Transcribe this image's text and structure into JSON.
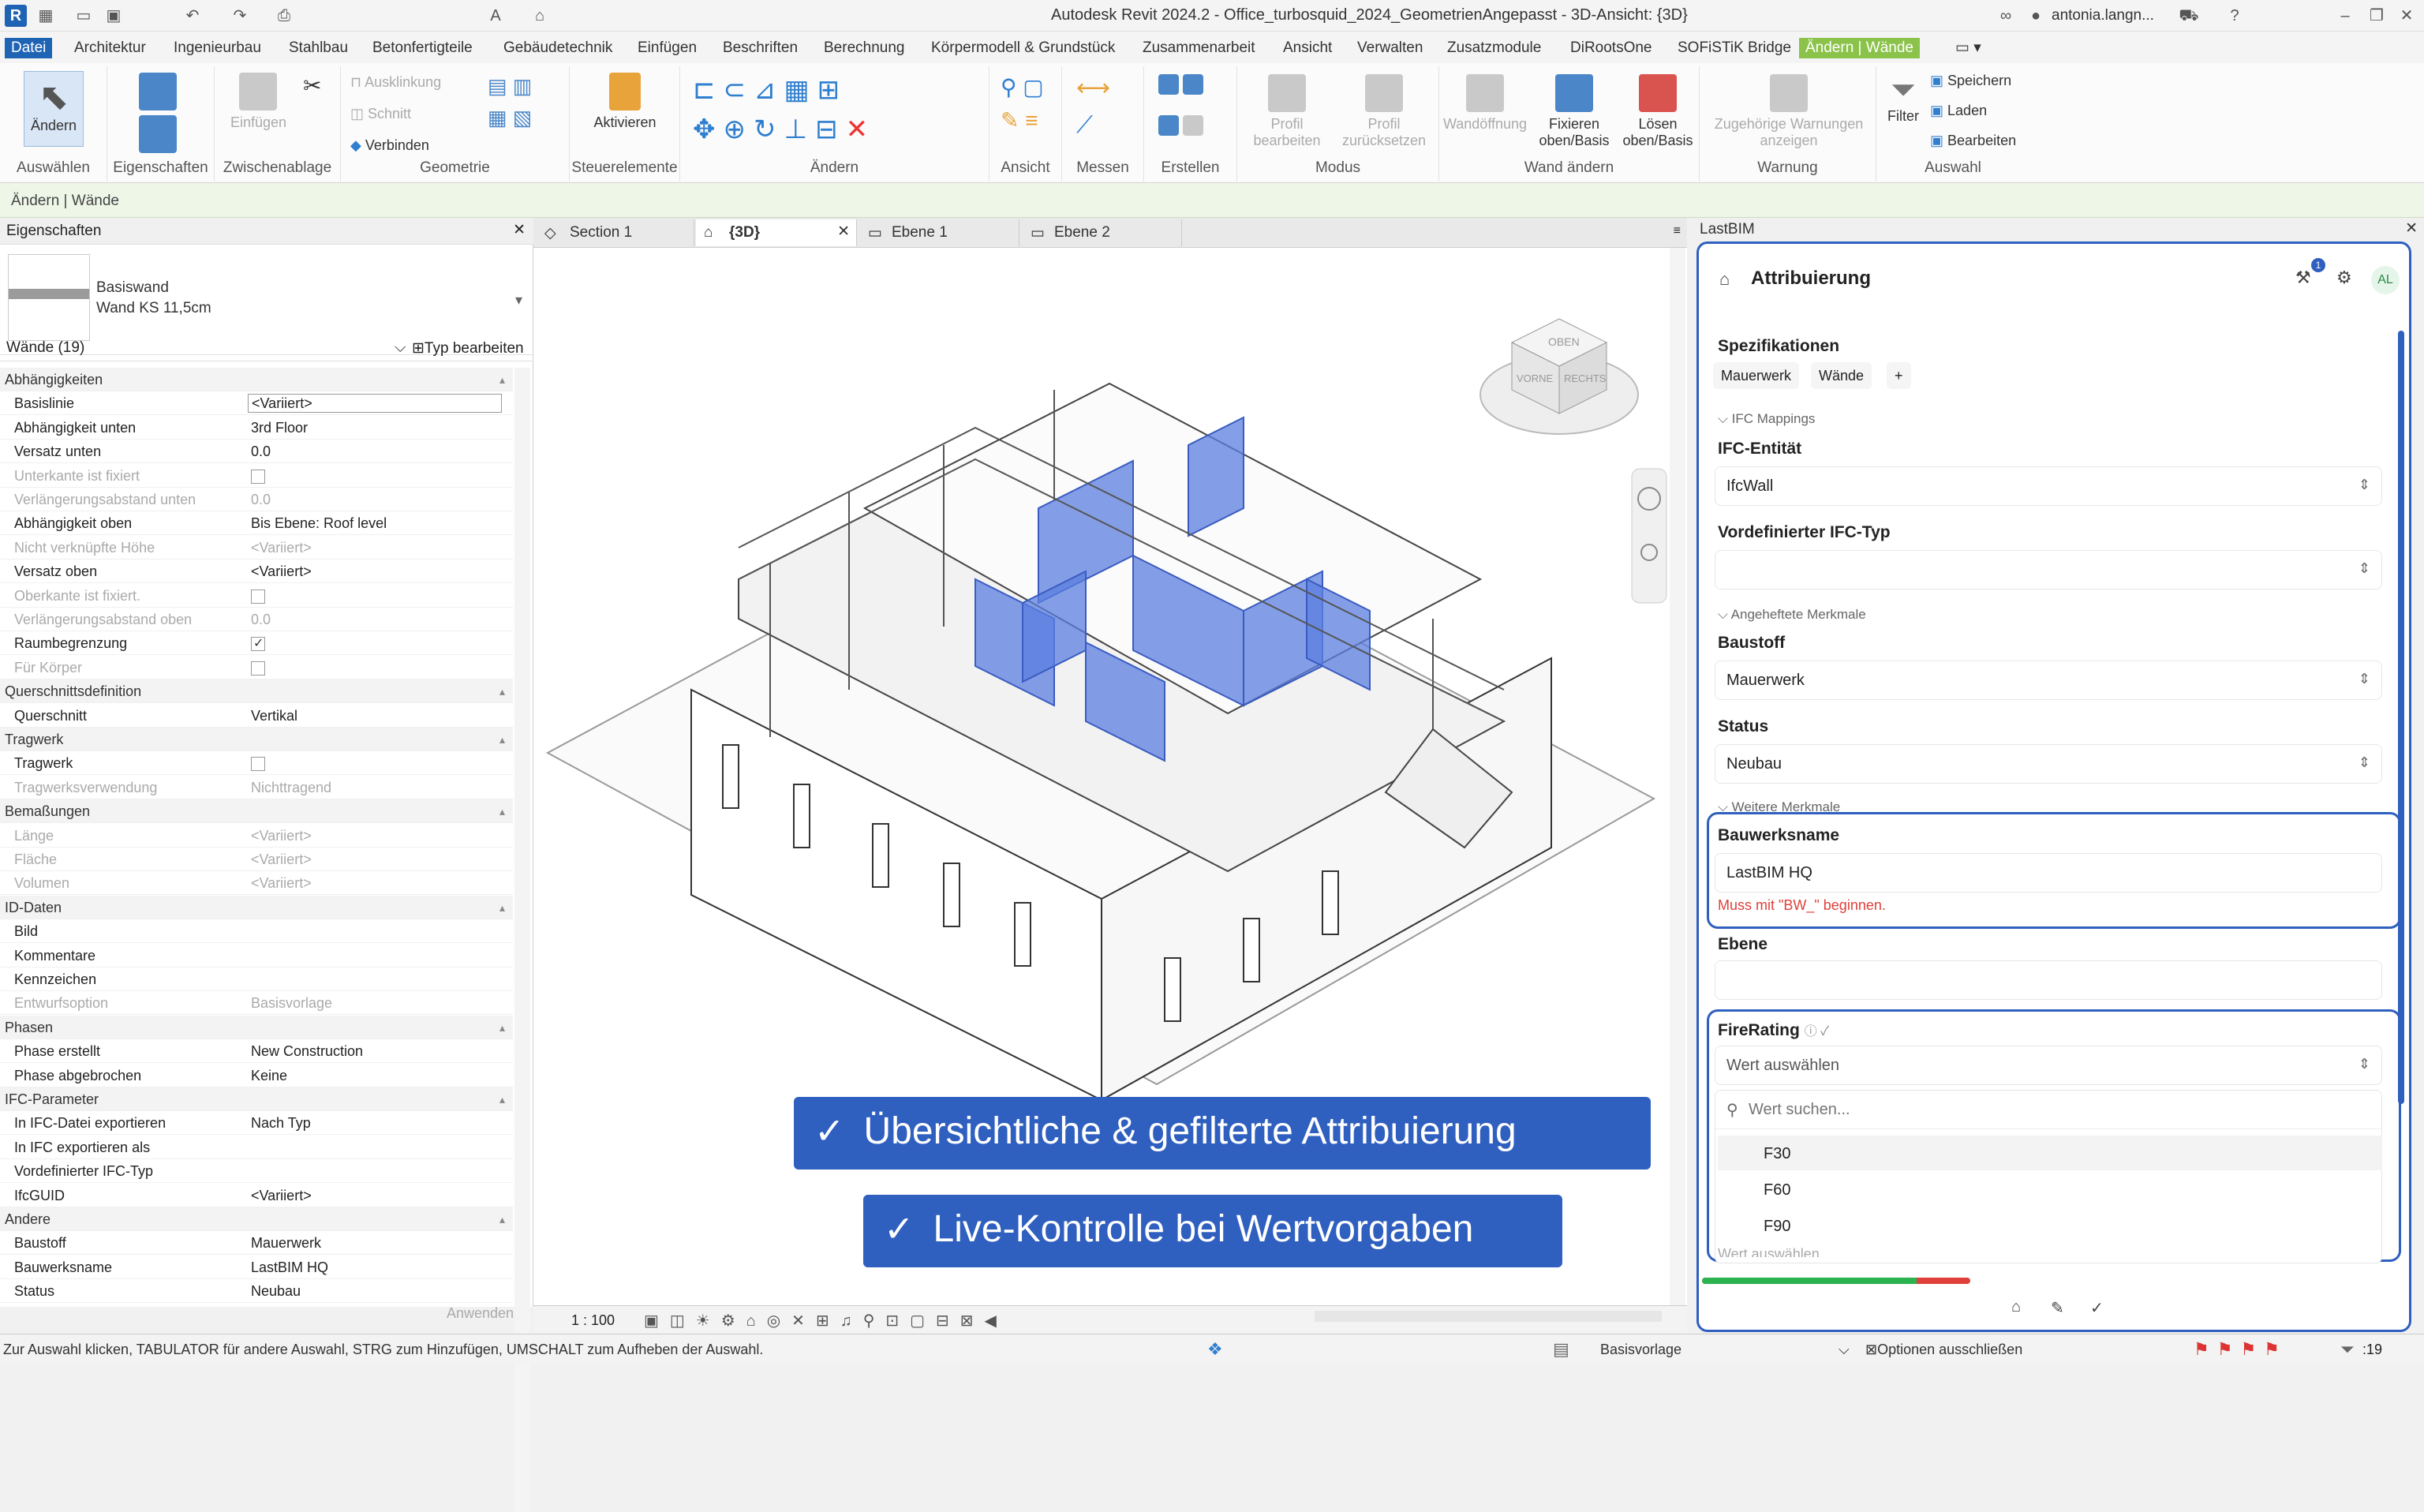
{
  "titlebar": {
    "title": "Autodesk Revit 2024.2 - Office_turbosquid_2024_GeometrienAngepasst - 3D-Ansicht: {3D}",
    "user": "antonia.langn..."
  },
  "menu": [
    "Datei",
    "Architektur",
    "Ingenieurbau",
    "Stahlbau",
    "Betonfertigteile",
    "Gebäudetechnik",
    "Einfügen",
    "Beschriften",
    "Berechnung",
    "Körpermodell & Grundstück",
    "Zusammenarbeit",
    "Ansicht",
    "Verwalten",
    "Zusatzmodule",
    "DiRootsOne",
    "SOFiSTiK Bridge",
    "Ändern | Wände"
  ],
  "ribbon": {
    "groups": [
      "Auswählen",
      "Eigenschaften",
      "Zwischenablage",
      "Geometrie",
      "Steuerelemente",
      "Ändern",
      "Ansicht",
      "Messen",
      "Erstellen",
      "Modus",
      "Wand ändern",
      "Warnung",
      "Auswahl"
    ],
    "btn_aendern": "Ändern",
    "btn_einfuegen": "Einfügen",
    "btn_ausklinkung": "Ausklinkung",
    "btn_schnitt": "Schnitt",
    "btn_verbinden": "Verbinden",
    "btn_aktivieren": "Aktivieren",
    "btn_profil_bearbeiten": "Profil bearbeiten",
    "btn_profil_zurueck": "Profil zurücksetzen",
    "btn_wandoeffnung": "Wandöffnung",
    "btn_fixieren": "Fixieren oben/Basis",
    "btn_loesen": "Lösen oben/Basis",
    "btn_warnungen": "Zugehörige Warnungen anzeigen",
    "btn_filter": "Filter",
    "btn_speichern": "Speichern",
    "btn_laden": "Laden",
    "btn_bearbeiten": "Bearbeiten"
  },
  "context_bar": "Ändern | Wände",
  "properties": {
    "header": "Eigenschaften",
    "type_name_1": "Basiswand",
    "type_name_2": "Wand KS 11,5cm",
    "filter": "Wände (19)",
    "edit_type": "Typ bearbeiten",
    "rows": [
      {
        "k": "Abhängigkeiten",
        "sec": true
      },
      {
        "k": "Basislinie",
        "v": "<Variiert>"
      },
      {
        "k": "Abhängigkeit unten",
        "v": "3rd Floor"
      },
      {
        "k": "Versatz unten",
        "v": "0.0"
      },
      {
        "k": "Unterkante ist fixiert",
        "cb": false,
        "dis": true
      },
      {
        "k": "Verlängerungsabstand unten",
        "v": "0.0",
        "dis": true
      },
      {
        "k": "Abhängigkeit oben",
        "v": "Bis Ebene: Roof level"
      },
      {
        "k": "Nicht verknüpfte Höhe",
        "v": "<Variiert>",
        "dis": true
      },
      {
        "k": "Versatz oben",
        "v": "<Variiert>"
      },
      {
        "k": "Oberkante ist fixiert.",
        "cb": false,
        "dis": true
      },
      {
        "k": "Verlängerungsabstand oben",
        "v": "0.0",
        "dis": true
      },
      {
        "k": "Raumbegrenzung",
        "cb": true
      },
      {
        "k": "Für Körper",
        "cb": false,
        "dis": true
      },
      {
        "k": "Querschnittsdefinition",
        "sec": true
      },
      {
        "k": "Querschnitt",
        "v": "Vertikal"
      },
      {
        "k": "Tragwerk",
        "sec": true
      },
      {
        "k": "Tragwerk",
        "cb": false
      },
      {
        "k": "Tragwerksverwendung",
        "v": "Nichttragend",
        "dis": true
      },
      {
        "k": "Bemaßungen",
        "sec": true
      },
      {
        "k": "Länge",
        "v": "<Variiert>",
        "dis": true
      },
      {
        "k": "Fläche",
        "v": "<Variiert>",
        "dis": true
      },
      {
        "k": "Volumen",
        "v": "<Variiert>",
        "dis": true
      },
      {
        "k": "ID-Daten",
        "sec": true
      },
      {
        "k": "Bild",
        "v": ""
      },
      {
        "k": "Kommentare",
        "v": ""
      },
      {
        "k": "Kennzeichen",
        "v": ""
      },
      {
        "k": "Entwurfsoption",
        "v": "Basisvorlage",
        "dis": true
      },
      {
        "k": "Phasen",
        "sec": true
      },
      {
        "k": "Phase erstellt",
        "v": "New Construction"
      },
      {
        "k": "Phase abgebrochen",
        "v": "Keine"
      },
      {
        "k": "IFC-Parameter",
        "sec": true
      },
      {
        "k": "In IFC-Datei exportieren",
        "v": "Nach Typ"
      },
      {
        "k": "In IFC exportieren als",
        "v": ""
      },
      {
        "k": "Vordefinierter IFC-Typ",
        "v": ""
      },
      {
        "k": "IfcGUID",
        "v": "<Variiert>"
      },
      {
        "k": "Andere",
        "sec": true
      },
      {
        "k": "Baustoff",
        "v": "Mauerwerk"
      },
      {
        "k": "Bauwerksname",
        "v": "LastBIM HQ"
      },
      {
        "k": "Status",
        "v": "Neubau"
      }
    ],
    "apply": "Anwenden"
  },
  "view_tabs": [
    "Section 1",
    "{3D}",
    "Ebene 1",
    "Ebene 2"
  ],
  "viewcube": {
    "top": "OBEN",
    "front": "VORNE",
    "right": "RECHTS"
  },
  "banners": [
    "Übersichtliche & gefilterte Attribuierung",
    "Live-Kontrolle bei Wertvorgaben"
  ],
  "view_scale": "1 : 100",
  "lastbim": {
    "header": "LastBIM",
    "title": "Attribuierung",
    "avatar": "AL",
    "spec_label": "Spezifikationen",
    "chips": [
      "Mauerwerk",
      "Wände",
      "+"
    ],
    "ifc_mappings": "IFC Mappings",
    "ifc_entity_label": "IFC-Entität",
    "ifc_entity_value": "IfcWall",
    "ifc_type_label": "Vordefinierter IFC-Typ",
    "attached": "Angeheftete Merkmale",
    "baustoff_label": "Baustoff",
    "baustoff_value": "Mauerwerk",
    "status_label": "Status",
    "status_value": "Neubau",
    "more": "Weitere Merkmale",
    "bauwerk_label": "Bauwerksname",
    "bauwerk_value": "LastBIM HQ",
    "bauwerk_error": "Muss mit \"BW_\" beginnen.",
    "ebene_label": "Ebene",
    "fire_label": "FireRating",
    "fire_placeholder": "Wert auswählen",
    "search_placeholder": "Wert suchen...",
    "options": [
      "F30",
      "F60",
      "F90"
    ],
    "cut_text": "Wert auswählen",
    "progress": 0.8
  },
  "status": {
    "hint": "Zur Auswahl klicken, TABULATOR für andere Auswahl, STRG zum Hinzufügen, UMSCHALT zum Aufheben der Auswahl.",
    "basis": "Basisvorlage",
    "options": "Optionen ausschließen",
    "count": ":19"
  },
  "colors": {
    "accent": "#2f5fbf",
    "ribbon_tab": "#1f63b4",
    "context_tab": "#8bc34a",
    "error": "#e0403a",
    "selection": "#5b7fe0"
  }
}
